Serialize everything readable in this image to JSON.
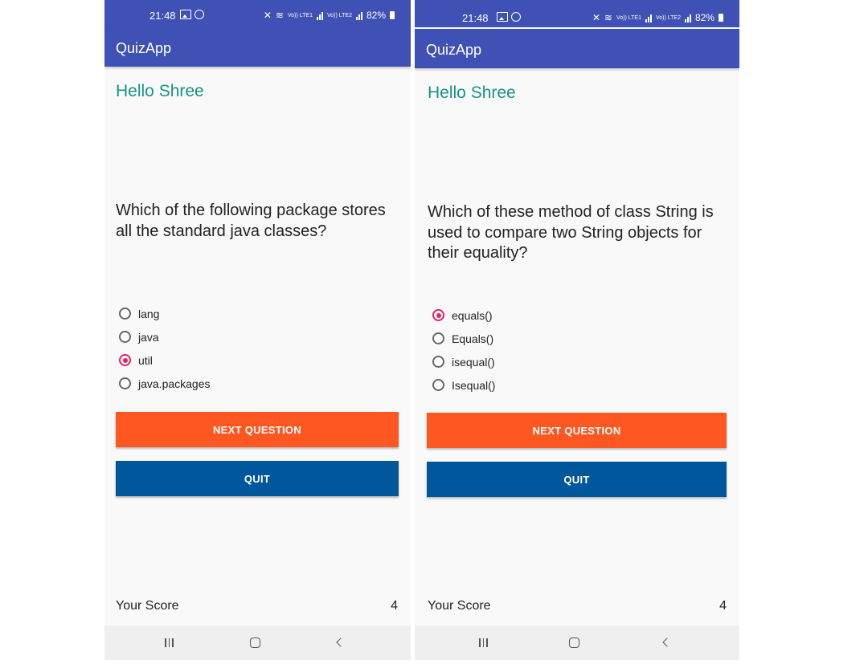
{
  "app": {
    "title": "QuizApp"
  },
  "screens": [
    {
      "status": {
        "time": "21:48",
        "battery": "82%",
        "net1": "Vo)) LTE1",
        "net2": "Vo)) LTE2"
      },
      "greeting": "Hello Shree",
      "question": "Which of the following package stores all the standard java classes?",
      "options": [
        {
          "label": "lang",
          "selected": false
        },
        {
          "label": "java",
          "selected": false
        },
        {
          "label": "util",
          "selected": true
        },
        {
          "label": "java.packages",
          "selected": false
        }
      ],
      "next_label": "NEXT QUESTION",
      "quit_label": "QUIT",
      "score_label": "Your Score",
      "score_value": "4"
    },
    {
      "status": {
        "time": "21:48",
        "battery": "82%",
        "net1": "Vo)) LTE1",
        "net2": "Vo)) LTE2"
      },
      "greeting": "Hello Shree",
      "question": "Which of these method of class String is used to compare two String objects for their equality?",
      "options": [
        {
          "label": "equals()",
          "selected": true
        },
        {
          "label": "Equals()",
          "selected": false
        },
        {
          "label": "isequal()",
          "selected": false
        },
        {
          "label": "Isequal()",
          "selected": false
        }
      ],
      "next_label": "NEXT QUESTION",
      "quit_label": "QUIT",
      "score_label": "Your Score",
      "score_value": "4"
    }
  ],
  "colors": {
    "primary": "#3f51b5",
    "greeting": "#169587",
    "next_button": "#ff5722",
    "quit_button": "#01579b",
    "radio_accent": "#e91e63"
  }
}
